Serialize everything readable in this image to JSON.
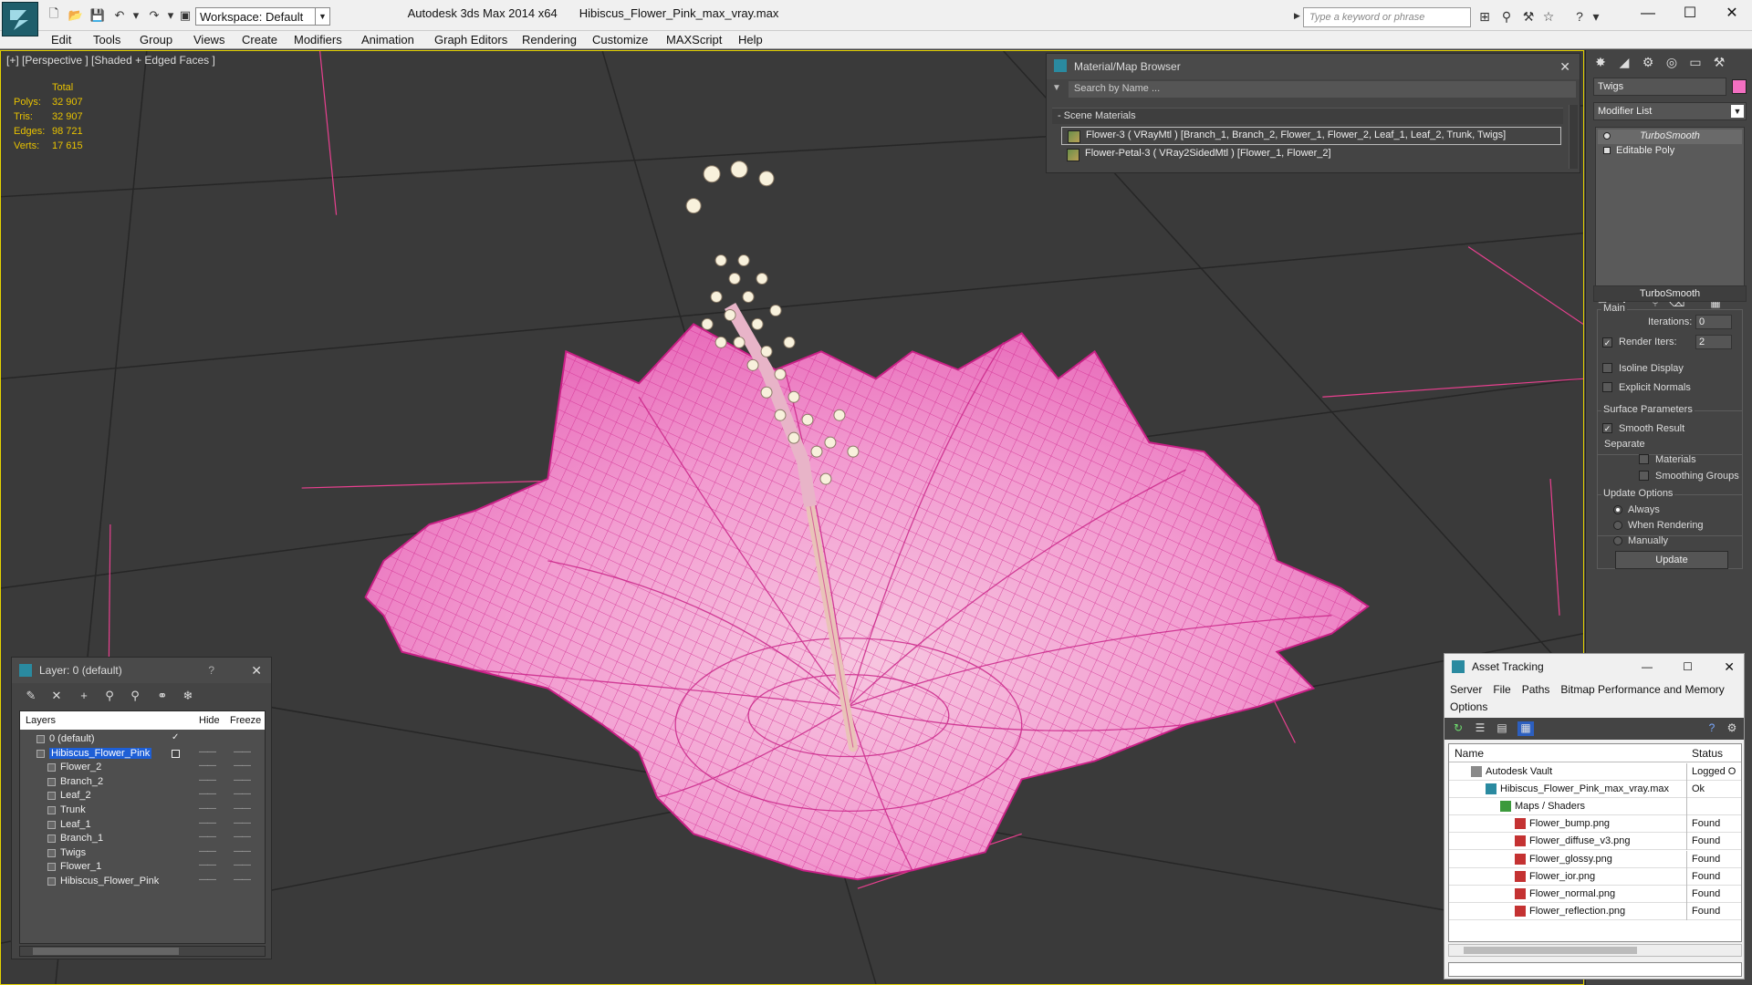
{
  "window": {
    "app_title": "Autodesk 3ds Max  2014 x64",
    "file_title": "Hibiscus_Flower_Pink_max_vray.max",
    "workspace": "Workspace: Default",
    "search_placeholder": "Type a keyword or phrase",
    "controls": {
      "minimize": "—",
      "maximize": "☐",
      "close": "✕"
    }
  },
  "menu": [
    "Edit",
    "Tools",
    "Group",
    "Views",
    "Create",
    "Modifiers",
    "Animation",
    "Graph Editors",
    "Rendering",
    "Customize",
    "MAXScript",
    "Help"
  ],
  "viewport": {
    "label": "[+] [Perspective ] [Shaded + Edged Faces ]",
    "stats": {
      "header": "Total",
      "rows": [
        {
          "k": "Polys:",
          "v": "32 907"
        },
        {
          "k": "Tris:",
          "v": "32 907"
        },
        {
          "k": "Edges:",
          "v": "98 721"
        },
        {
          "k": "Verts:",
          "v": "17 615"
        }
      ]
    }
  },
  "material_browser": {
    "title": "Material/Map Browser",
    "search_placeholder": "Search by Name ...",
    "section": "- Scene Materials",
    "materials": [
      "Flower-3  ( VRayMtl )  [Branch_1, Branch_2, Flower_1, Flower_2, Leaf_1, Leaf_2, Trunk, Twigs]",
      "Flower-Petal-3  ( VRay2SidedMtl )  [Flower_1, Flower_2]"
    ]
  },
  "command_panel": {
    "object_name": "Twigs",
    "object_color": "#f36fc1",
    "modifier_list": "Modifier List",
    "stack": [
      "TurboSmooth",
      "Editable Poly"
    ],
    "rollout_title": "TurboSmooth",
    "main_group": "Main",
    "iterations_label": "Iterations:",
    "iterations_value": "0",
    "render_iters_label": "Render Iters:",
    "render_iters_value": "2",
    "isoline_label": "Isoline Display",
    "explicit_normals_label": "Explicit Normals",
    "surface_group": "Surface Parameters",
    "smooth_result_label": "Smooth Result",
    "separate_label": "Separate",
    "materials_label": "Materials",
    "smoothing_groups_label": "Smoothing Groups",
    "update_group": "Update Options",
    "always_label": "Always",
    "when_rendering_label": "When Rendering",
    "manually_label": "Manually",
    "update_button": "Update"
  },
  "layer_explorer": {
    "title": "Layer: 0 (default)",
    "help": "?",
    "columns": {
      "layers": "Layers",
      "hide": "Hide",
      "freeze": "Freeze"
    },
    "rows": [
      {
        "name": "0 (default)",
        "indent": 0
      },
      {
        "name": "Hibiscus_Flower_Pink",
        "indent": 0
      },
      {
        "name": "Flower_2",
        "indent": 1
      },
      {
        "name": "Branch_2",
        "indent": 1
      },
      {
        "name": "Leaf_2",
        "indent": 1
      },
      {
        "name": "Trunk",
        "indent": 1
      },
      {
        "name": "Leaf_1",
        "indent": 1
      },
      {
        "name": "Branch_1",
        "indent": 1
      },
      {
        "name": "Twigs",
        "indent": 1
      },
      {
        "name": "Flower_1",
        "indent": 1
      },
      {
        "name": "Hibiscus_Flower_Pink",
        "indent": 1
      }
    ],
    "dash": "——"
  },
  "asset_tracking": {
    "title": "Asset Tracking",
    "menu": [
      "Server",
      "File",
      "Paths",
      "Bitmap Performance and Memory",
      "Options"
    ],
    "columns": {
      "name": "Name",
      "status": "Status"
    },
    "rows": [
      {
        "name": "Autodesk Vault",
        "status": "Logged O"
      },
      {
        "name": "Hibiscus_Flower_Pink_max_vray.max",
        "status": "Ok"
      },
      {
        "name": "Maps / Shaders",
        "status": ""
      },
      {
        "name": "Flower_bump.png",
        "status": "Found"
      },
      {
        "name": "Flower_diffuse_v3.png",
        "status": "Found"
      },
      {
        "name": "Flower_glossy.png",
        "status": "Found"
      },
      {
        "name": "Flower_ior.png",
        "status": "Found"
      },
      {
        "name": "Flower_normal.png",
        "status": "Found"
      },
      {
        "name": "Flower_reflection.png",
        "status": "Found"
      }
    ]
  }
}
